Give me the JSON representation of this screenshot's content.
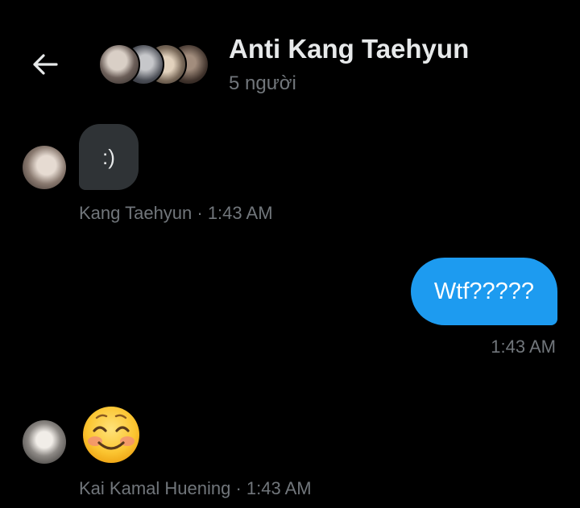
{
  "header": {
    "back_icon": "arrow-left-icon",
    "title": "Anti Kang Taehyun",
    "subtitle": "5 người"
  },
  "messages": [
    {
      "sender": "Kang Taehyun",
      "text": ":)",
      "meta": "Kang Taehyun · 1:43 AM",
      "direction": "incoming"
    },
    {
      "text": "Wtf?????",
      "meta": "1:43 AM",
      "direction": "outgoing"
    },
    {
      "sender": "Kai Kamal Huening",
      "emoji_icon": "smiling-face-with-smiling-eyes-icon",
      "meta": "Kai Kamal Huening · 1:43 AM",
      "direction": "incoming"
    }
  ],
  "colors": {
    "background": "#000000",
    "outgoing_bubble": "#1d9bf0",
    "incoming_bubble": "#2f3336",
    "muted_text": "#71767b",
    "primary_text": "#e7e9ea"
  }
}
